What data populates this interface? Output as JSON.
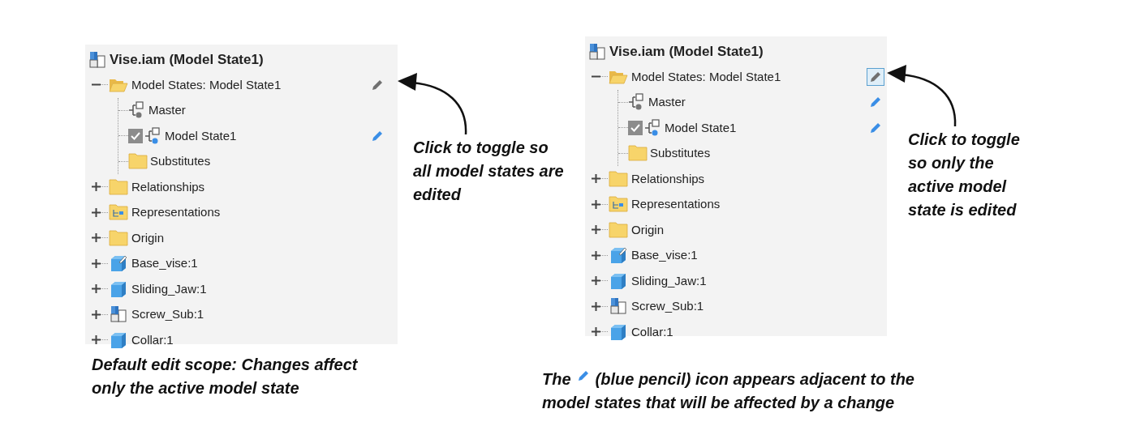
{
  "panels": [
    {
      "title": "Vise.iam (Model State1)",
      "callout": "Click to toggle so all model states are edited",
      "nodes": [
        {
          "label": "Model States: Model State1",
          "kind": "folder",
          "expanded": true,
          "toggle": {
            "selected": false
          },
          "children": [
            {
              "label": "Master",
              "kind": "state",
              "checked": false,
              "edited": false
            },
            {
              "label": "Model State1",
              "kind": "state",
              "checked": true,
              "edited": true
            },
            {
              "label": "Substitutes",
              "kind": "folder"
            }
          ]
        },
        {
          "label": "Relationships",
          "kind": "folder",
          "expanded": false
        },
        {
          "label": "Representations",
          "kind": "representations",
          "expanded": false
        },
        {
          "label": "Origin",
          "kind": "folder",
          "expanded": false
        },
        {
          "label": "Base_vise:1",
          "kind": "part-modified",
          "expanded": false
        },
        {
          "label": "Sliding_Jaw:1",
          "kind": "part",
          "expanded": false
        },
        {
          "label": "Screw_Sub:1",
          "kind": "assembly",
          "expanded": false
        },
        {
          "label": "Collar:1",
          "kind": "part",
          "expanded": false
        }
      ]
    },
    {
      "title": "Vise.iam (Model State1)",
      "callout": "Click to toggle so only the active model state is edited",
      "nodes": [
        {
          "label": "Model States: Model State1",
          "kind": "folder",
          "expanded": true,
          "toggle": {
            "selected": true
          },
          "children": [
            {
              "label": "Master",
              "kind": "state",
              "checked": false,
              "edited": true
            },
            {
              "label": "Model State1",
              "kind": "state",
              "checked": true,
              "edited": true
            },
            {
              "label": "Substitutes",
              "kind": "folder"
            }
          ]
        },
        {
          "label": "Relationships",
          "kind": "folder",
          "expanded": false
        },
        {
          "label": "Representations",
          "kind": "representations",
          "expanded": false
        },
        {
          "label": "Origin",
          "kind": "folder",
          "expanded": false
        },
        {
          "label": "Base_vise:1",
          "kind": "part-modified",
          "expanded": false
        },
        {
          "label": "Sliding_Jaw:1",
          "kind": "part",
          "expanded": false
        },
        {
          "label": "Screw_Sub:1",
          "kind": "assembly",
          "expanded": false
        },
        {
          "label": "Collar:1",
          "kind": "part",
          "expanded": false
        }
      ]
    }
  ],
  "captions": {
    "left": "Default edit scope: Changes affect only the active model state",
    "right": {
      "lead": "The",
      "lines": [
        "(blue pencil) icon appears adjacent to the",
        "model states that will be affected by a change"
      ]
    }
  }
}
